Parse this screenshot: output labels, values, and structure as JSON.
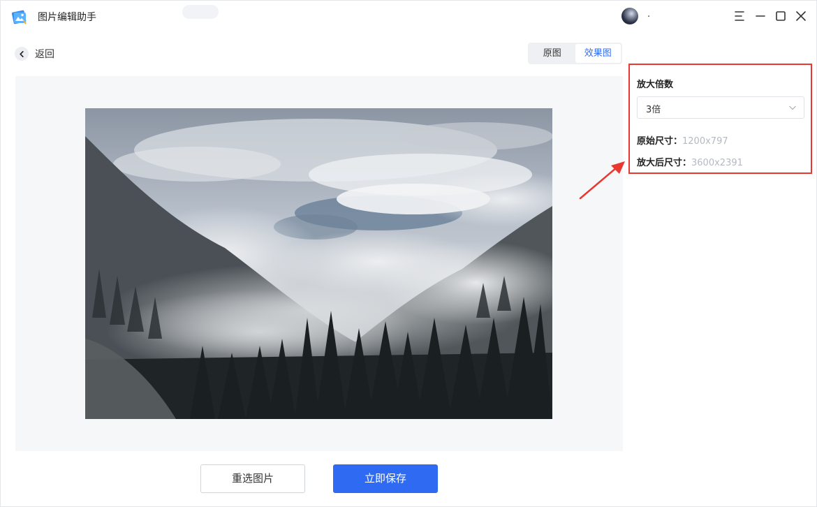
{
  "window": {
    "app_title": "图片编辑助手",
    "username": ".",
    "controls": [
      "menu-icon",
      "minimize-icon",
      "maximize-icon",
      "close-icon"
    ]
  },
  "nav": {
    "back_label": "返回"
  },
  "view_toggle": {
    "tabs": [
      {
        "label": "原图",
        "active": false
      },
      {
        "label": "效果图",
        "active": true
      }
    ]
  },
  "settings": {
    "scale_title": "放大倍数",
    "scale_selected": "3倍",
    "original_size_label": "原始尺寸：",
    "original_size_value": "1200x797",
    "enlarged_size_label": "放大后尺寸：",
    "enlarged_size_value": "3600x2391"
  },
  "actions": {
    "reselect_label": "重选图片",
    "save_label": "立即保存"
  },
  "colors": {
    "accent": "#2f6bf2",
    "highlight_border": "#e8382f",
    "muted_value": "#b4b9c2",
    "preview_bg": "#f6f7f9"
  },
  "icons": {
    "app_logo": "photo-editor-logo-icon",
    "back": "chevron-left-icon",
    "select": "chevron-down-icon",
    "callout": "red-arrow-icon"
  }
}
